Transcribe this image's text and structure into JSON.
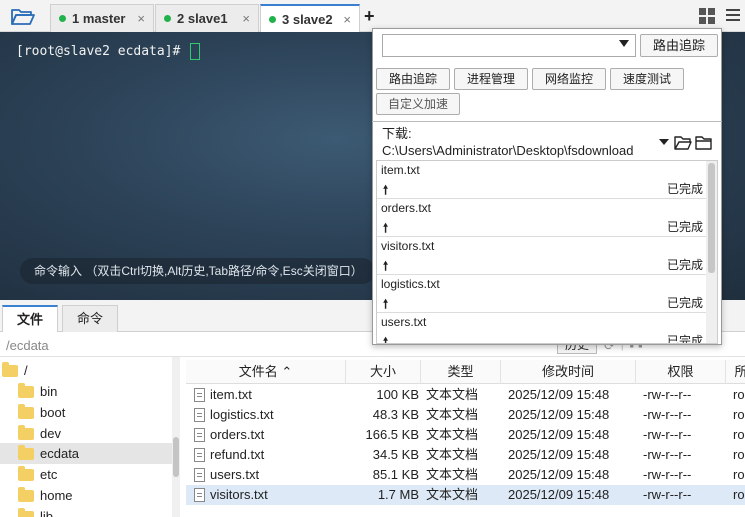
{
  "tabs": [
    {
      "label": "1 master",
      "close": "×"
    },
    {
      "label": "2 slave1",
      "close": "×"
    },
    {
      "label": "3 slave2",
      "close": "×"
    }
  ],
  "new_tab_label": "+",
  "terminal": {
    "prompt": "[root@slave2 ecdata]#",
    "command_hint": "命令输入 （双击Ctrl切换,Alt历史,Tab路径/命令,Esc关闭窗口）"
  },
  "lower_tabs": [
    "文件",
    "命令"
  ],
  "path": "/ecdata",
  "history_button": "历史",
  "tree": [
    {
      "name": "/",
      "level": 0
    },
    {
      "name": "bin",
      "level": 1
    },
    {
      "name": "boot",
      "level": 1
    },
    {
      "name": "dev",
      "level": 1
    },
    {
      "name": "ecdata",
      "level": 1,
      "selected": true
    },
    {
      "name": "etc",
      "level": 1
    },
    {
      "name": "home",
      "level": 1
    },
    {
      "name": "lib",
      "level": 1
    }
  ],
  "file_table": {
    "columns": [
      "文件名",
      "大小",
      "类型",
      "修改时间",
      "权限",
      "所"
    ],
    "rows": [
      {
        "name": "item.txt",
        "size": "100 KB",
        "type": "文本文档",
        "mtime": "2025/12/09 15:48",
        "perm": "-rw-r--r--",
        "owner": "ro"
      },
      {
        "name": "logistics.txt",
        "size": "48.3 KB",
        "type": "文本文档",
        "mtime": "2025/12/09 15:48",
        "perm": "-rw-r--r--",
        "owner": "ro"
      },
      {
        "name": "orders.txt",
        "size": "166.5 KB",
        "type": "文本文档",
        "mtime": "2025/12/09 15:48",
        "perm": "-rw-r--r--",
        "owner": "ro"
      },
      {
        "name": "refund.txt",
        "size": "34.5 KB",
        "type": "文本文档",
        "mtime": "2025/12/09 15:48",
        "perm": "-rw-r--r--",
        "owner": "ro"
      },
      {
        "name": "users.txt",
        "size": "85.1 KB",
        "type": "文本文档",
        "mtime": "2025/12/09 15:48",
        "perm": "-rw-r--r--",
        "owner": "ro"
      },
      {
        "name": "visitors.txt",
        "size": "1.7 MB",
        "type": "文本文档",
        "mtime": "2025/12/09 15:48",
        "perm": "-rw-r--r--",
        "owner": "ro",
        "selected": true
      }
    ]
  },
  "popup": {
    "route_button": "路由追踪",
    "tool_buttons": [
      "路由追踪",
      "进程管理",
      "网络监控",
      "速度测试",
      "自定义加速"
    ],
    "download_path": "下载: C:\\Users\\Administrator\\Desktop\\fsdownload",
    "downloads": [
      {
        "name": "item.txt",
        "status": "已完成"
      },
      {
        "name": "orders.txt",
        "status": "已完成"
      },
      {
        "name": "visitors.txt",
        "status": "已完成"
      },
      {
        "name": "logistics.txt",
        "status": "已完成"
      },
      {
        "name": "users.txt",
        "status": "已完成"
      }
    ],
    "upload_arrow": "🠕"
  },
  "colors": {
    "accent": "#3b7fd1",
    "status_dot": "#21b24b",
    "terminal_bg": "#2c4257"
  }
}
